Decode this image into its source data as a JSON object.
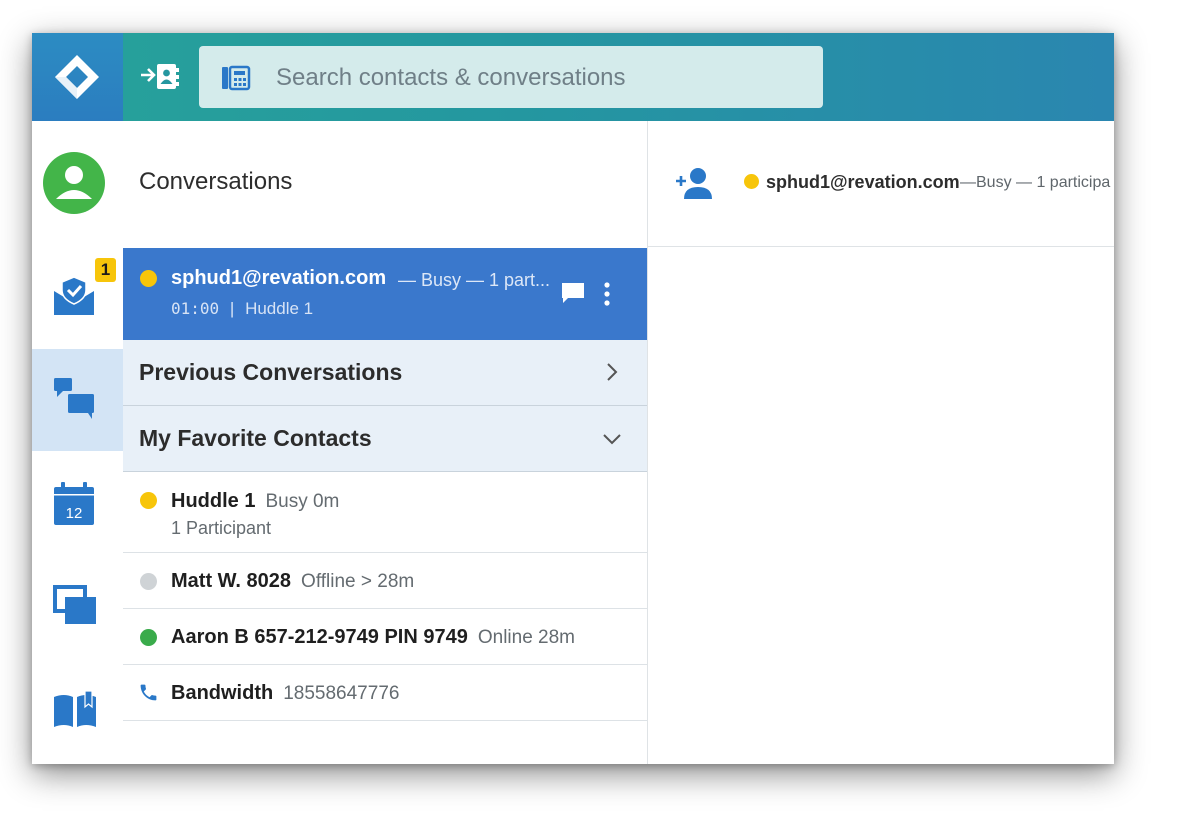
{
  "search": {
    "placeholder": "Search contacts & conversations"
  },
  "nav": {
    "badge_count": "1",
    "calendar_day": "12"
  },
  "conversations": {
    "title": "Conversations",
    "active": {
      "name": "sphud1@revation.com",
      "status": "— Busy — 1 part...",
      "timer": "01:00",
      "separator": "|",
      "location": "Huddle 1",
      "status_color": "#f7c50a"
    },
    "previous_label": "Previous Conversations",
    "favorites_label": "My Favorite Contacts",
    "contacts": [
      {
        "name": "Huddle 1",
        "status": "Busy 0m",
        "sub": "1 Participant",
        "status_color": "#f7c50a"
      },
      {
        "name": "Matt W. 8028",
        "status": "Offline > 28m",
        "status_color": "#cfd3d6"
      },
      {
        "name": "Aaron B 657-212-9749 PIN 9749",
        "status": "Online 28m",
        "status_color": "#3aab4b"
      },
      {
        "name": "Bandwidth",
        "status": "18558647776",
        "icon": "phone-icon"
      }
    ]
  },
  "detail": {
    "name": "sphud1@revation.com",
    "status": "—Busy — 1 participa"
  },
  "colors": {
    "accent": "#3a78cc",
    "busy": "#f7c50a",
    "online": "#3aab4b",
    "offline": "#cfd3d6",
    "icon_blue": "#2a78c8"
  }
}
